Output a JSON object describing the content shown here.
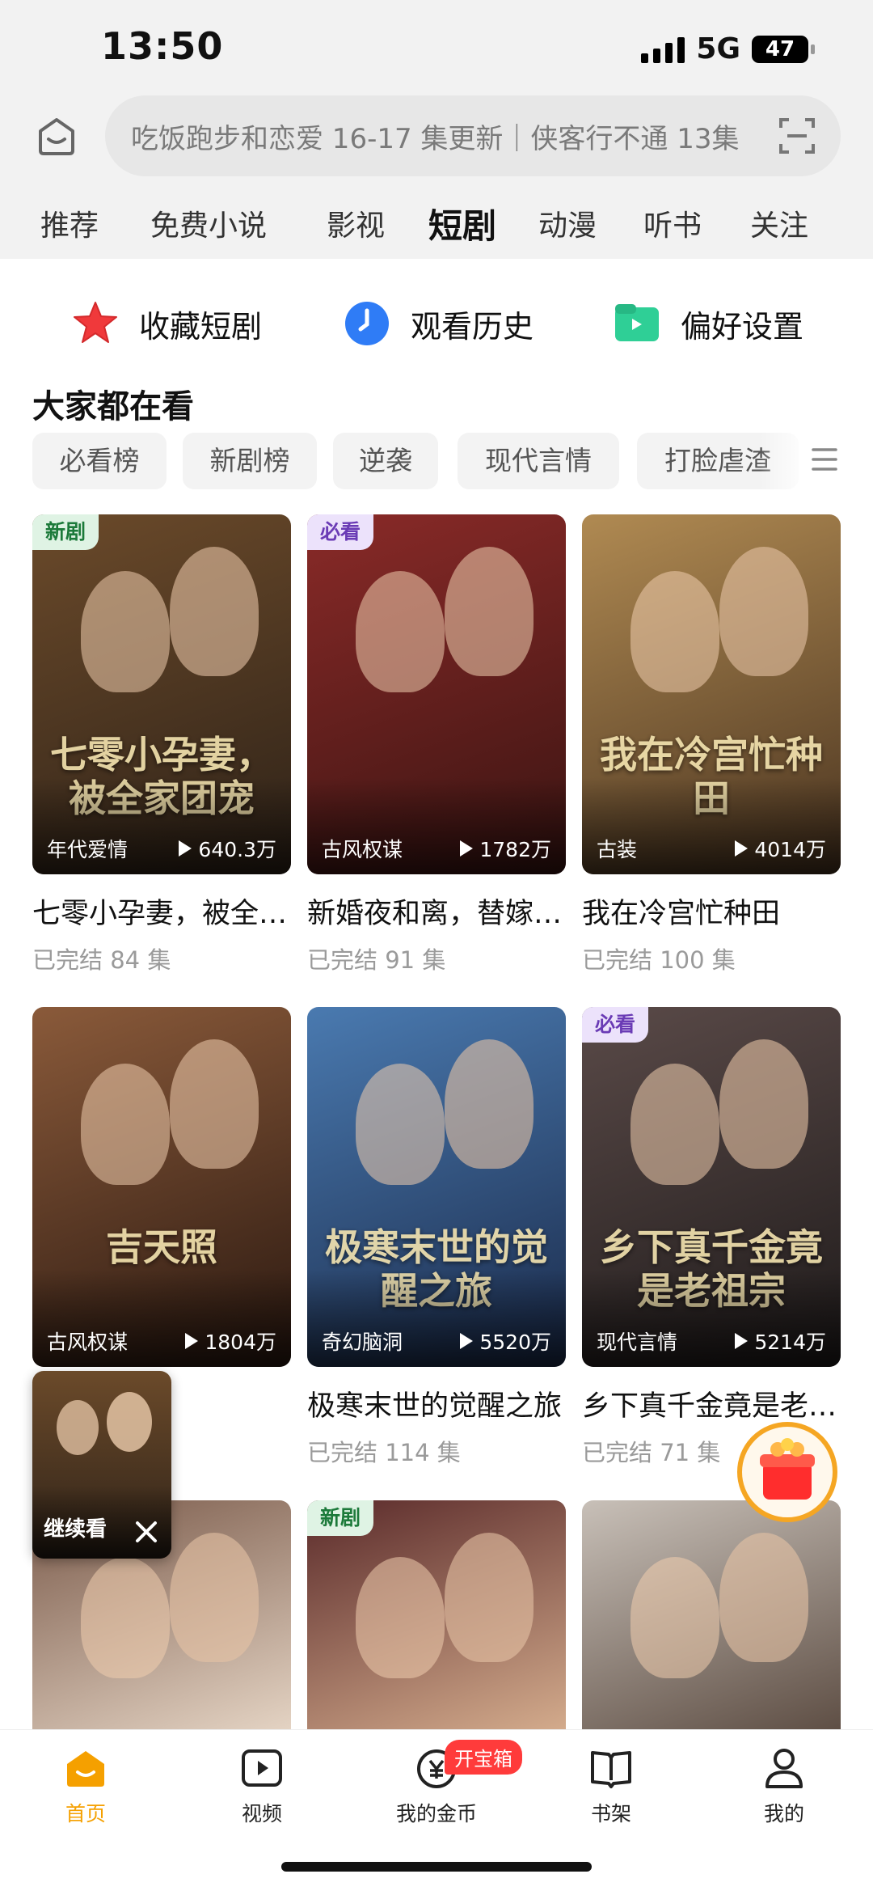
{
  "status_bar": {
    "time": "13:50",
    "network": "5G",
    "battery": "47"
  },
  "search": {
    "text": "吃饭跑步和恋爱 16-17 集更新｜侠客行不通 13集"
  },
  "top_tabs": [
    {
      "label": "推荐"
    },
    {
      "label": "免费小说"
    },
    {
      "label": "影视"
    },
    {
      "label": "短剧",
      "active": true
    },
    {
      "label": "动漫"
    },
    {
      "label": "听书"
    },
    {
      "label": "关注"
    }
  ],
  "quick_actions": [
    {
      "label": "收藏短剧",
      "icon": "star-icon"
    },
    {
      "label": "观看历史",
      "icon": "clock-icon"
    },
    {
      "label": "偏好设置",
      "icon": "folder-icon"
    }
  ],
  "section": {
    "title": "大家都在看"
  },
  "chips": [
    "必看榜",
    "新剧榜",
    "逆袭",
    "现代言情",
    "打脸虐渣"
  ],
  "cards": [
    {
      "badge": "新剧",
      "badge_type": "new",
      "genre": "年代爱情",
      "views": "640.3万",
      "title": "七零小孕妻，被全家团宠",
      "status": "已完结",
      "episodes": "84 集",
      "poster_text": "七零小孕妻，被全家团宠",
      "colors": [
        "#6b4a2a",
        "#2e2218"
      ]
    },
    {
      "badge": "必看",
      "badge_type": "must",
      "genre": "古风权谋",
      "views": "1782万",
      "title": "新婚夜和离，替嫁王妃",
      "status": "已完结",
      "episodes": "91 集",
      "poster_text": "",
      "colors": [
        "#8a2a28",
        "#3a1412"
      ]
    },
    {
      "badge": "",
      "badge_type": "",
      "genre": "古装",
      "views": "4014万",
      "title": "我在冷宫忙种田",
      "status": "已完结",
      "episodes": "100 集",
      "poster_text": "我在冷宫忙种田",
      "colors": [
        "#b08a52",
        "#4a3420"
      ]
    },
    {
      "badge": "",
      "badge_type": "",
      "genre": "古风权谋",
      "views": "1804万",
      "title": "",
      "status": "",
      "episodes": "",
      "poster_text": "吉天照",
      "colors": [
        "#8a5a3a",
        "#2a1810"
      ]
    },
    {
      "badge": "",
      "badge_type": "",
      "genre": "奇幻脑洞",
      "views": "5520万",
      "title": "极寒末世的觉醒之旅",
      "status": "已完结",
      "episodes": "114 集",
      "poster_text": "极寒末世的觉醒之旅",
      "colors": [
        "#4a7ab0",
        "#1a2a4a"
      ]
    },
    {
      "badge": "必看",
      "badge_type": "must",
      "genre": "现代言情",
      "views": "5214万",
      "title": "乡下真千金竟是老祖宗",
      "status": "已完结",
      "episodes": "71 集",
      "poster_text": "乡下真千金竟是老祖宗",
      "colors": [
        "#5a4a48",
        "#1e1a1a"
      ]
    },
    {
      "badge": "",
      "badge_type": "",
      "genre": "",
      "views": "",
      "title": "",
      "status": "",
      "episodes": "",
      "poster_text": "",
      "colors": [
        "#7a5a4a",
        "#e8d8c8"
      ]
    },
    {
      "badge": "新剧",
      "badge_type": "new",
      "genre": "",
      "views": "",
      "title": "",
      "status": "",
      "episodes": "",
      "poster_text": "",
      "colors": [
        "#5a2a2a",
        "#d8b090"
      ]
    },
    {
      "badge": "",
      "badge_type": "",
      "genre": "",
      "views": "",
      "title": "",
      "status": "",
      "episodes": "",
      "poster_text": "",
      "colors": [
        "#c8c0b8",
        "#5a4a40"
      ]
    }
  ],
  "mini_player": {
    "label": "继续看"
  },
  "bottom_nav": [
    {
      "label": "首页",
      "icon": "home-icon",
      "active": true
    },
    {
      "label": "视频",
      "icon": "video-icon"
    },
    {
      "label": "我的金币",
      "icon": "coin-icon",
      "badge": "开宝箱"
    },
    {
      "label": "书架",
      "icon": "book-icon"
    },
    {
      "label": "我的",
      "icon": "profile-icon"
    }
  ],
  "colors": {
    "accent": "#f5a000",
    "badge_red": "#ff3b3b",
    "header_bg": "#f2f2f2"
  }
}
